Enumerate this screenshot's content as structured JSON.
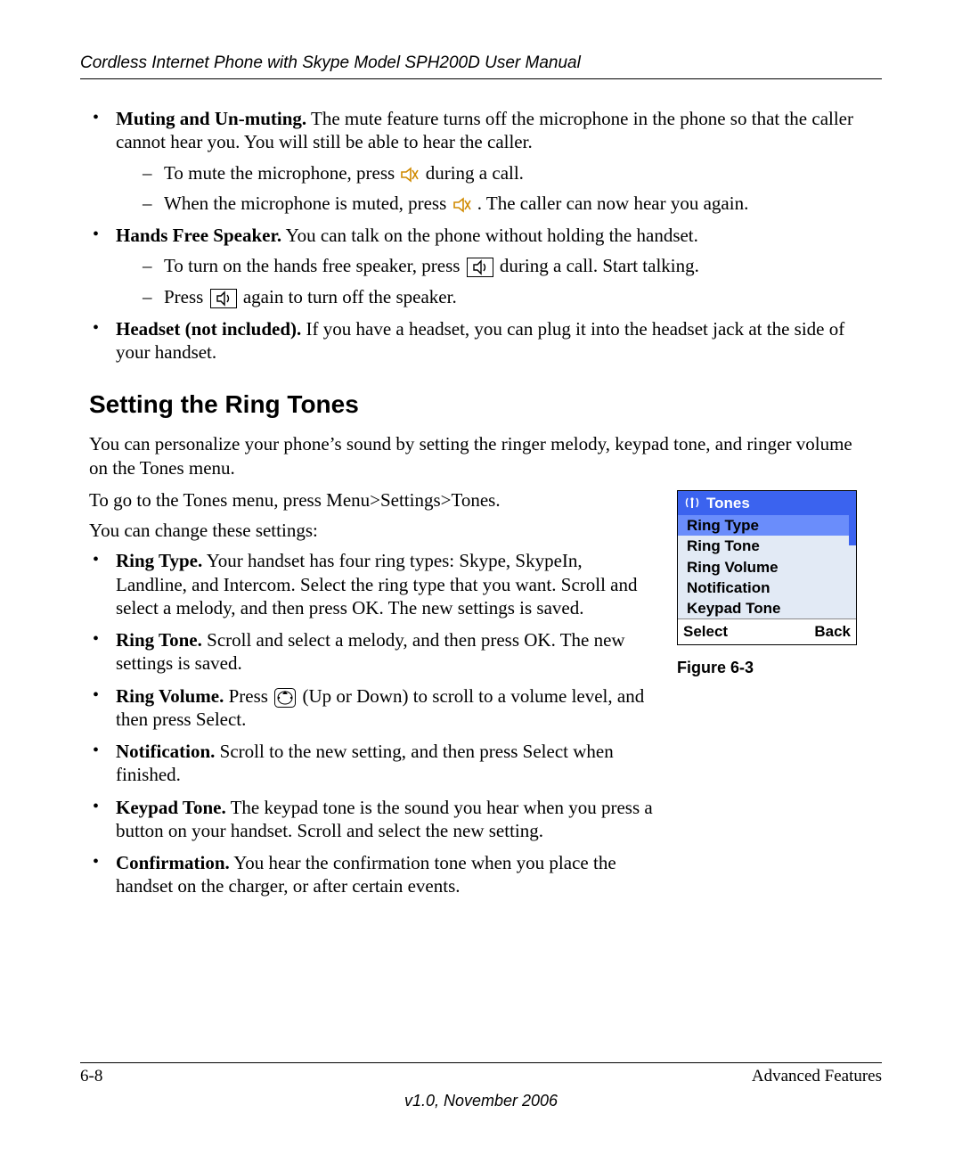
{
  "header": "Cordless Internet Phone with Skype Model SPH200D User Manual",
  "top_bullets": [
    {
      "title": "Muting and Un-muting.",
      "text": " The mute feature turns off the microphone in the phone so that the caller cannot hear you. You will still be able to hear the caller.",
      "subs": [
        {
          "pre": "To mute the microphone, press ",
          "icon": "mute",
          "post": " during a call."
        },
        {
          "pre": "When the microphone is muted, press ",
          "icon": "mute",
          "post": " . The caller can now hear you again."
        }
      ]
    },
    {
      "title": "Hands Free Speaker.",
      "text": " You can talk on the phone without holding the handset.",
      "subs": [
        {
          "pre": "To turn on the hands free speaker, press ",
          "icon": "speaker",
          "post": " during a call. Start talking."
        },
        {
          "pre": "Press ",
          "icon": "speaker",
          "post": " again to turn off the speaker."
        }
      ]
    },
    {
      "title": "Headset (not included).",
      "text": " If you have a headset, you can plug it into the headset jack at the side of your handset.",
      "subs": []
    }
  ],
  "section_heading": "Setting the Ring Tones",
  "intro_p1": "You can personalize your phone’s sound by setting the ringer melody, keypad tone, and ringer volume on the Tones menu.",
  "intro_p2": "To go to the Tones menu, press Menu>Settings>Tones.",
  "intro_p3": "You can change these settings:",
  "settings": [
    {
      "title": "Ring Type.",
      "text": " Your handset has four ring types: Skype, SkypeIn, Landline, and Intercom. Select the ring type that you want. Scroll and select a melody, and then press OK. The new settings is saved."
    },
    {
      "title": "Ring Tone.",
      "text": " Scroll and select a melody, and then press OK. The new settings is saved."
    },
    {
      "title": "Ring Volume.",
      "pre": " Press ",
      "icon": "nav",
      "post": " (Up or Down) to scroll to a volume level, and then press Select."
    },
    {
      "title": "Notification.",
      "text": " Scroll to the new setting, and then press Select when finished."
    },
    {
      "title": "Keypad Tone.",
      "text": " The keypad tone is the sound you hear when you press a button on your handset. Scroll and select the new setting."
    },
    {
      "title": "Confirmation.",
      "text": " You hear the confirmation tone when you place the handset on the charger, or after certain events."
    }
  ],
  "phone_menu": {
    "title": "Tones",
    "items": [
      "Ring Type",
      "Ring Tone",
      "Ring Volume",
      "Notification",
      "Keypad Tone"
    ],
    "selected_index": 0,
    "soft_left": "Select",
    "soft_right": "Back"
  },
  "figure_caption": "Figure 6-3",
  "footer": {
    "page": "6-8",
    "section": "Advanced Features",
    "version": "v1.0, November 2006"
  }
}
